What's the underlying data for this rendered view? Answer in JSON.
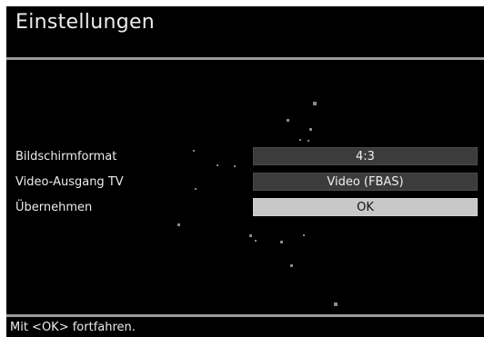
{
  "header": {
    "title": "Einstellungen"
  },
  "settings": [
    {
      "label": "Bildschirmformat",
      "value": "4:3"
    },
    {
      "label": "Video-Ausgang TV",
      "value": "Video (FBAS)"
    },
    {
      "label": "Übernehmen",
      "value": "OK"
    }
  ],
  "footer": {
    "hint": "Mit <OK> fortfahren."
  },
  "colors": {
    "background": "#000000",
    "value_box": "#3c3c3c",
    "selected_box": "#c8c8c8",
    "separator": "#9a9a9a"
  }
}
